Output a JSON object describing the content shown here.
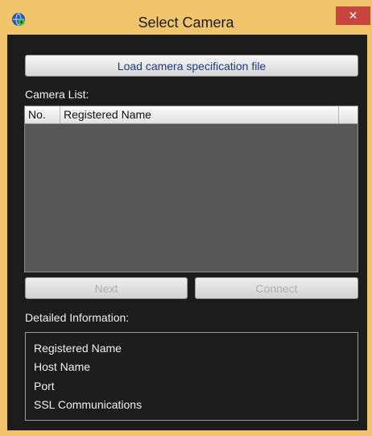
{
  "window": {
    "title": "Select Camera",
    "icon": "camera-globe-icon",
    "close_icon": "close-icon",
    "close_glyph": "✕",
    "frame_color": "#f2c46c",
    "close_color": "#c7453f"
  },
  "toolbar": {
    "load_label": "Load camera specification file"
  },
  "camera_list": {
    "label": "Camera List:",
    "columns": [
      "No.",
      "Registered Name"
    ],
    "rows": []
  },
  "actions": {
    "next_label": "Next",
    "connect_label": "Connect",
    "next_enabled": false,
    "connect_enabled": false
  },
  "details": {
    "label": "Detailed Information:",
    "items": [
      "Registered Name",
      "Host Name",
      "Port",
      "SSL Communications"
    ]
  }
}
